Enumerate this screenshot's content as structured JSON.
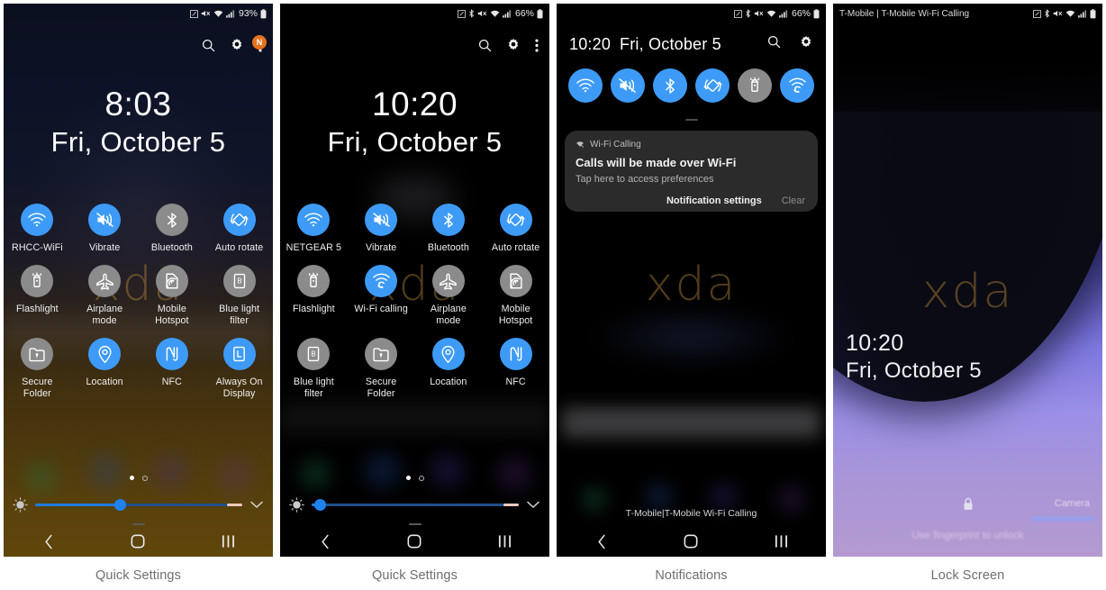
{
  "captions": [
    {
      "label": "Quick Settings"
    },
    {
      "label": "Quick Settings"
    },
    {
      "label": "Notifications"
    },
    {
      "label": "Lock Screen"
    }
  ],
  "colors": {
    "tile_on": "#3d9bf7",
    "tile_off": "#8b8b8b",
    "badge": "#e8721c",
    "slider_fill": "#1f7ae0",
    "caption_text": "#6e6e74"
  },
  "panel1": {
    "name": "Quick Settings",
    "status_bar": {
      "battery_percent": "93%",
      "icons": [
        "nfc-icon",
        "mute-icon",
        "wifi-icon",
        "signal-icon",
        "battery-icon"
      ]
    },
    "header_icons": [
      {
        "name": "search-icon"
      },
      {
        "name": "gear-icon"
      },
      {
        "name": "overflow-menu-icon",
        "badge": "N"
      }
    ],
    "clock": {
      "time": "8:03",
      "date": "Fri, October 5"
    },
    "watermark": "xda",
    "tiles": [
      {
        "label": "RHCC-WiFi",
        "icon": "wifi-icon",
        "state": "on"
      },
      {
        "label": "Vibrate",
        "icon": "vibrate-icon",
        "state": "on"
      },
      {
        "label": "Bluetooth",
        "icon": "bluetooth-icon",
        "state": "off"
      },
      {
        "label": "Auto rotate",
        "icon": "autorotate-icon",
        "state": "on"
      },
      {
        "label": "Flashlight",
        "icon": "flashlight-icon",
        "state": "off"
      },
      {
        "label": "Airplane mode",
        "icon": "airplane-icon",
        "state": "off"
      },
      {
        "label": "Mobile Hotspot",
        "icon": "hotspot-icon",
        "state": "off"
      },
      {
        "label": "Blue light filter",
        "icon": "bluelight-icon",
        "state": "off"
      },
      {
        "label": "Secure Folder",
        "icon": "securefolder-icon",
        "state": "off"
      },
      {
        "label": "Location",
        "icon": "location-icon",
        "state": "on"
      },
      {
        "label": "NFC",
        "icon": "nfc-icon",
        "state": "on"
      },
      {
        "label": "Always On Display",
        "icon": "aod-icon",
        "state": "on"
      }
    ],
    "pager": {
      "pages": 2,
      "active": 1
    },
    "brightness": {
      "value_percent": 41
    },
    "nav": [
      {
        "name": "back-button"
      },
      {
        "name": "home-button"
      },
      {
        "name": "recents-button"
      }
    ]
  },
  "panel2": {
    "name": "Quick Settings",
    "status_bar": {
      "battery_percent": "66%",
      "icons": [
        "nfc-icon",
        "bluetooth-icon",
        "mute-icon",
        "wifi-icon",
        "signal-icon",
        "battery-icon"
      ]
    },
    "header_icons": [
      {
        "name": "search-icon"
      },
      {
        "name": "gear-icon"
      },
      {
        "name": "overflow-menu-icon"
      }
    ],
    "clock": {
      "time": "10:20",
      "date": "Fri, October 5"
    },
    "watermark": "xda",
    "tiles": [
      {
        "label": "NETGEAR 5",
        "icon": "wifi-icon",
        "state": "on"
      },
      {
        "label": "Vibrate",
        "icon": "vibrate-icon",
        "state": "on"
      },
      {
        "label": "Bluetooth",
        "icon": "bluetooth-icon",
        "state": "on"
      },
      {
        "label": "Auto rotate",
        "icon": "autorotate-icon",
        "state": "on"
      },
      {
        "label": "Flashlight",
        "icon": "flashlight-icon",
        "state": "off"
      },
      {
        "label": "Wi-Fi calling",
        "icon": "wifi-calling-icon",
        "state": "on"
      },
      {
        "label": "Airplane mode",
        "icon": "airplane-icon",
        "state": "off"
      },
      {
        "label": "Mobile Hotspot",
        "icon": "hotspot-icon",
        "state": "off"
      },
      {
        "label": "Blue light filter",
        "icon": "bluelight-icon",
        "state": "off"
      },
      {
        "label": "Secure Folder",
        "icon": "securefolder-icon",
        "state": "off"
      },
      {
        "label": "Location",
        "icon": "location-icon",
        "state": "on"
      },
      {
        "label": "NFC",
        "icon": "nfc-icon",
        "state": "on"
      }
    ],
    "pager": {
      "pages": 2,
      "active": 1
    },
    "brightness": {
      "value_percent": 4
    },
    "nav": [
      {
        "name": "back-button"
      },
      {
        "name": "home-button"
      },
      {
        "name": "recents-button"
      }
    ]
  },
  "panel3": {
    "name": "Notifications",
    "status_bar": {
      "battery_percent": "66%",
      "icons": [
        "nfc-icon",
        "bluetooth-icon",
        "mute-icon",
        "wifi-icon",
        "signal-icon",
        "battery-icon"
      ]
    },
    "header": {
      "time": "10:20",
      "date": "Fri, October 5",
      "icons": [
        {
          "name": "search-icon"
        },
        {
          "name": "gear-icon"
        }
      ]
    },
    "quick_tiles": [
      {
        "icon": "wifi-icon",
        "state": "on"
      },
      {
        "icon": "vibrate-icon",
        "state": "on"
      },
      {
        "icon": "bluetooth-icon",
        "state": "on"
      },
      {
        "icon": "autorotate-icon",
        "state": "on"
      },
      {
        "icon": "flashlight-icon",
        "state": "off"
      },
      {
        "icon": "wifi-calling-icon",
        "state": "on"
      }
    ],
    "notification": {
      "app": "Wi-Fi Calling",
      "title": "Calls will be made over Wi-Fi",
      "subtitle": "Tap here to access preferences",
      "action_primary": "Notification settings",
      "action_secondary": "Clear"
    },
    "watermark": "xda",
    "carrier": "T-Mobile|T-Mobile Wi-Fi Calling",
    "nav": [
      {
        "name": "back-button"
      },
      {
        "name": "home-button"
      },
      {
        "name": "recents-button"
      }
    ]
  },
  "panel4": {
    "name": "Lock Screen",
    "status_bar": {
      "carrier": "T-Mobile | T-Mobile Wi-Fi Calling",
      "icons": [
        "nfc-icon",
        "bluetooth-icon",
        "mute-icon",
        "wifi-icon",
        "signal-icon",
        "battery-icon"
      ]
    },
    "watermark": "xda",
    "clock": {
      "time": "10:20",
      "date": "Fri, October 5"
    },
    "lock_icon": "lock-icon",
    "hint": "Use fingerprint to unlock",
    "camera_shortcut": "Camera"
  }
}
